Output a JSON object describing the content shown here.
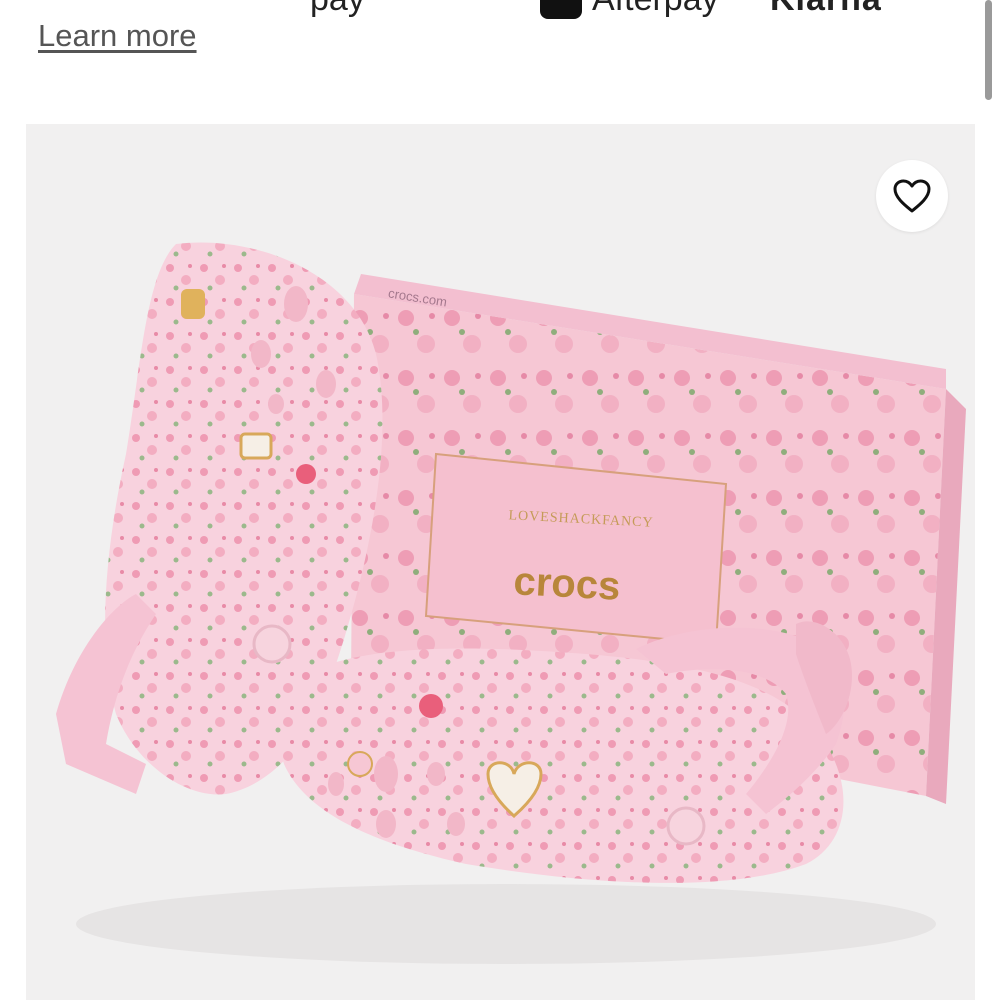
{
  "header": {
    "cut_text_left": "pay",
    "afterpay_label": "Afterpay",
    "cut_text_right": "Klarna",
    "learn_more": "Learn more"
  },
  "product": {
    "box_brand_line": "LOVESHACKFANCY",
    "box_logo": "crocs",
    "box_side_text": "crocs.com",
    "wishlist_icon": "heart-icon"
  },
  "colors": {
    "link": "#555555",
    "pink_light": "#f7cfdc",
    "pink_mid": "#f3b3c6",
    "box_label": "#f5c0cf",
    "logo_gold": "#b8863b"
  }
}
